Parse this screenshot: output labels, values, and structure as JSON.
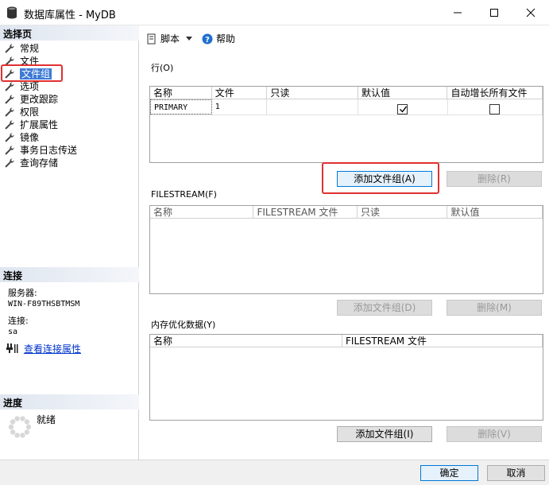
{
  "window": {
    "title": "数据库属性 - MyDB"
  },
  "left": {
    "select_page_header": "选择页",
    "nav_items": [
      {
        "label": "常规"
      },
      {
        "label": "文件"
      },
      {
        "label": "文件组"
      },
      {
        "label": "选项"
      },
      {
        "label": "更改跟踪"
      },
      {
        "label": "权限"
      },
      {
        "label": "扩展属性"
      },
      {
        "label": "镜像"
      },
      {
        "label": "事务日志传送"
      },
      {
        "label": "查询存储"
      }
    ],
    "selected_index": 2,
    "connection_header": "连接",
    "server_label": "服务器:",
    "server_value": "WIN-F89THSBTMSM",
    "conn_label": "连接:",
    "conn_value": "sa",
    "view_conn_link": "查看连接属性",
    "progress_header": "进度",
    "progress_status": "就绪"
  },
  "toolbar": {
    "script_label": "脚本",
    "help_label": "帮助"
  },
  "rows_section": {
    "label": "行(O)",
    "columns": [
      "名称",
      "文件",
      "只读",
      "默认值",
      "自动增长所有文件"
    ],
    "rows": [
      {
        "name": "PRIMARY",
        "files": "1",
        "readonly": "",
        "default": true,
        "autogrow": false
      }
    ],
    "add_button": "添加文件组(A)",
    "remove_button": "删除(R)"
  },
  "filestream_section": {
    "label": "FILESTREAM(F)",
    "columns": [
      "名称",
      "FILESTREAM 文件",
      "只读",
      "默认值"
    ],
    "add_button": "添加文件组(D)",
    "remove_button": "删除(M)"
  },
  "memory_section": {
    "label": "内存优化数据(Y)",
    "columns": [
      "名称",
      "FILESTREAM 文件"
    ],
    "add_button": "添加文件组(I)",
    "remove_button": "删除(V)"
  },
  "footer": {
    "ok_button": "确定",
    "cancel_button": "取消"
  },
  "colors": {
    "selection": "#3f7ad4",
    "highlight_box": "#e03030",
    "link": "#0033cc"
  }
}
